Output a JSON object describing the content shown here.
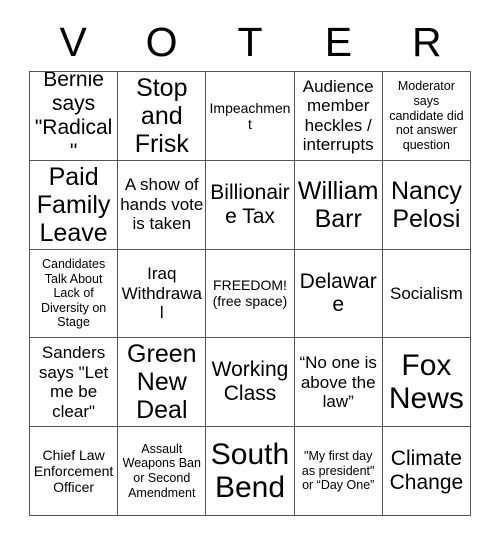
{
  "card": {
    "header_letters": [
      "V",
      "O",
      "T",
      "E",
      "R"
    ],
    "free_space_index": 12,
    "colors": {
      "background": "#ffffff",
      "text": "#000000",
      "grid_line": "#555555"
    },
    "cells": [
      {
        "text": "Bernie says \"Radical\"",
        "size": "lg"
      },
      {
        "text": "Stop and Frisk",
        "size": "xl"
      },
      {
        "text": "Impeachment",
        "size": "sm"
      },
      {
        "text": "Audience member heckles / interrupts",
        "size": "md"
      },
      {
        "text": "Moderator says candidate did not answer question",
        "size": "xs"
      },
      {
        "text": "Paid Family Leave",
        "size": "xl"
      },
      {
        "text": "A show of hands vote is taken",
        "size": "md"
      },
      {
        "text": "Billionaire Tax",
        "size": "lg"
      },
      {
        "text": "William Barr",
        "size": "xl"
      },
      {
        "text": "Nancy Pelosi",
        "size": "xl"
      },
      {
        "text": "Candidates Talk About Lack of Diversity on Stage",
        "size": "xs"
      },
      {
        "text": "Iraq Withdrawal",
        "size": "md"
      },
      {
        "text": "FREEDOM! (free space)",
        "size": "sm"
      },
      {
        "text": "Delaware",
        "size": "lg"
      },
      {
        "text": "Socialism",
        "size": "md"
      },
      {
        "text": "Sanders says \"Let me be clear\"",
        "size": "md"
      },
      {
        "text": "Green New Deal",
        "size": "xl"
      },
      {
        "text": "Working Class",
        "size": "lg"
      },
      {
        "text": "“No one is above the law”",
        "size": "md"
      },
      {
        "text": "Fox News",
        "size": "xxl"
      },
      {
        "text": "Chief Law Enforcement Officer",
        "size": "sm"
      },
      {
        "text": "Assault Weapons Ban or Second Amendment",
        "size": "xs"
      },
      {
        "text": "South Bend",
        "size": "xxl"
      },
      {
        "text": "\"My first day as president\" or “Day One”",
        "size": "xs"
      },
      {
        "text": "Climate Change",
        "size": "lg"
      }
    ]
  }
}
